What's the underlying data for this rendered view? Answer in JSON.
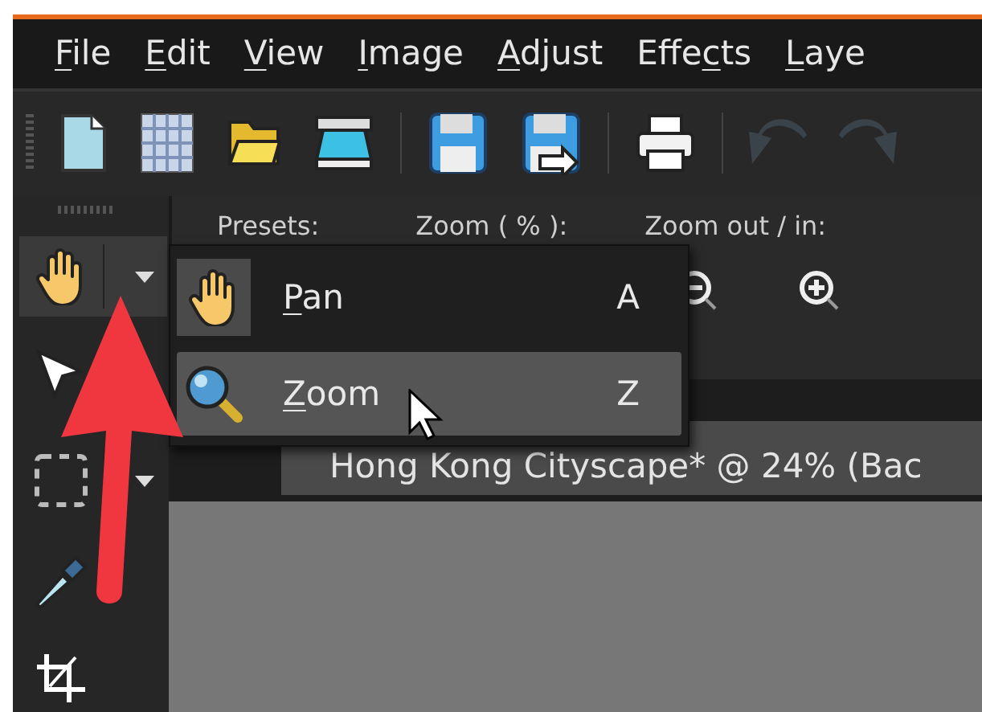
{
  "menu_bar": [
    {
      "key": "F",
      "after": "ile"
    },
    {
      "key": "E",
      "after": "dit"
    },
    {
      "key": "V",
      "after": "iew"
    },
    {
      "key": "I",
      "after": "mage"
    },
    {
      "key": "A",
      "after": "djust"
    },
    {
      "before": "Effe",
      "key": "c",
      "after": "ts"
    },
    {
      "key": "L",
      "after": "aye"
    }
  ],
  "toolbar": [
    {
      "kind": "new",
      "disabled": false
    },
    {
      "kind": "grid",
      "disabled": false
    },
    {
      "kind": "open",
      "disabled": false
    },
    {
      "kind": "scan",
      "disabled": false
    },
    {
      "kind": "save",
      "disabled": false
    },
    {
      "kind": "save-as",
      "disabled": false
    },
    {
      "kind": "print",
      "disabled": false
    },
    {
      "kind": "undo",
      "disabled": true
    },
    {
      "kind": "redo",
      "disabled": true
    }
  ],
  "tool_options": {
    "labels": [
      "Presets:",
      "Zoom ( % ):",
      "Zoom out / in:"
    ],
    "buttons": [
      {
        "kind": "zoom-out"
      },
      {
        "kind": "zoom-in"
      }
    ]
  },
  "toolbox": [
    {
      "kind": "pan",
      "dropdown": true,
      "active": true
    },
    {
      "kind": "pointer",
      "dropdown": false,
      "active": false
    },
    {
      "kind": "selection",
      "dropdown": true,
      "active": false
    },
    {
      "kind": "dropper",
      "dropdown": false,
      "active": false
    },
    {
      "kind": "crop",
      "dropdown": false,
      "active": false
    }
  ],
  "flyout_menu": [
    {
      "kind": "pan",
      "key": "P",
      "after": "an",
      "shortcut": "A",
      "current": true,
      "selected": false
    },
    {
      "kind": "zoom",
      "key": "Z",
      "after": "oom",
      "shortcut": "Z",
      "current": false,
      "selected": true
    }
  ],
  "document_tab": {
    "title": "Hong Kong Cityscape* @  24% (Bac"
  }
}
